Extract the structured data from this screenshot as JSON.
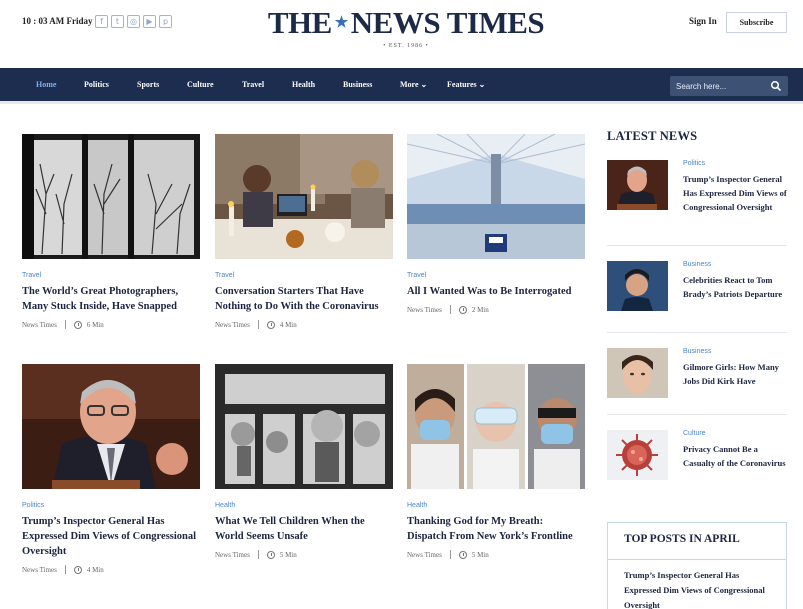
{
  "header": {
    "datetime": "10 : 03 AM Friday",
    "logo_left": "THE",
    "logo_right": "NEWS TIMES",
    "logo_est": "• EST. 1986 •",
    "signin_label": "Sign In",
    "subscribe_label": "Subscribe",
    "social_icons": [
      "facebook-icon",
      "twitter-icon",
      "instagram-icon",
      "youtube-icon",
      "pinterest-icon"
    ]
  },
  "nav": {
    "items": [
      {
        "label": "Home"
      },
      {
        "label": "Politics"
      },
      {
        "label": "Sports"
      },
      {
        "label": "Culture"
      },
      {
        "label": "Travel"
      },
      {
        "label": "Health"
      },
      {
        "label": "Business"
      },
      {
        "label": "More ⌄"
      },
      {
        "label": "Features ⌄"
      }
    ],
    "search_placeholder": "Search here..."
  },
  "articles": [
    {
      "category": "Travel",
      "title": "The World’s Great Photographers, Many Stuck Inside, Have Snapped",
      "author": "News Times",
      "read_time": "6 Min"
    },
    {
      "category": "Travel",
      "title": "Conversation Starters That Have Nothing to Do With the Coronavirus",
      "author": "News Times",
      "read_time": "4 Min"
    },
    {
      "category": "Travel",
      "title": "All I Wanted Was to Be Interrogated",
      "author": "News Times",
      "read_time": "2 Min"
    },
    {
      "category": "Politics",
      "title": "Trump’s Inspector General Has Expressed Dim Views of Congressional Oversight",
      "author": "News Times",
      "read_time": "4 Min"
    },
    {
      "category": "Health",
      "title": "What We Tell Children When the World Seems Unsafe",
      "author": "News Times",
      "read_time": "5 Min"
    },
    {
      "category": "Health",
      "title": "Thanking God for My Breath: Dispatch From New York’s Frontline",
      "author": "News Times",
      "read_time": "5 Min"
    }
  ],
  "latest": {
    "heading": "LATEST NEWS",
    "items": [
      {
        "category": "Politics",
        "title": "Trump’s Inspector General Has Expressed Dim Views of Congressional Oversight"
      },
      {
        "category": "Business",
        "title": "Celebrities React to Tom Brady’s Patriots Departure"
      },
      {
        "category": "Business",
        "title": "Gilmore Girls: How Many Jobs Did Kirk Have"
      },
      {
        "category": "Culture",
        "title": "Privacy Cannot Be a Casualty of the Coronavirus"
      }
    ]
  },
  "top_posts": {
    "heading": "TOP POSTS IN APRIL",
    "items": [
      {
        "title": "Trump’s Inspector General Has Expressed Dim Views of Congressional Oversight"
      }
    ]
  },
  "colors": {
    "nav_bg": "#1c2d4f",
    "accent": "#4a86c8",
    "active_nav": "#7fb0ea",
    "text": "#1c2541"
  }
}
